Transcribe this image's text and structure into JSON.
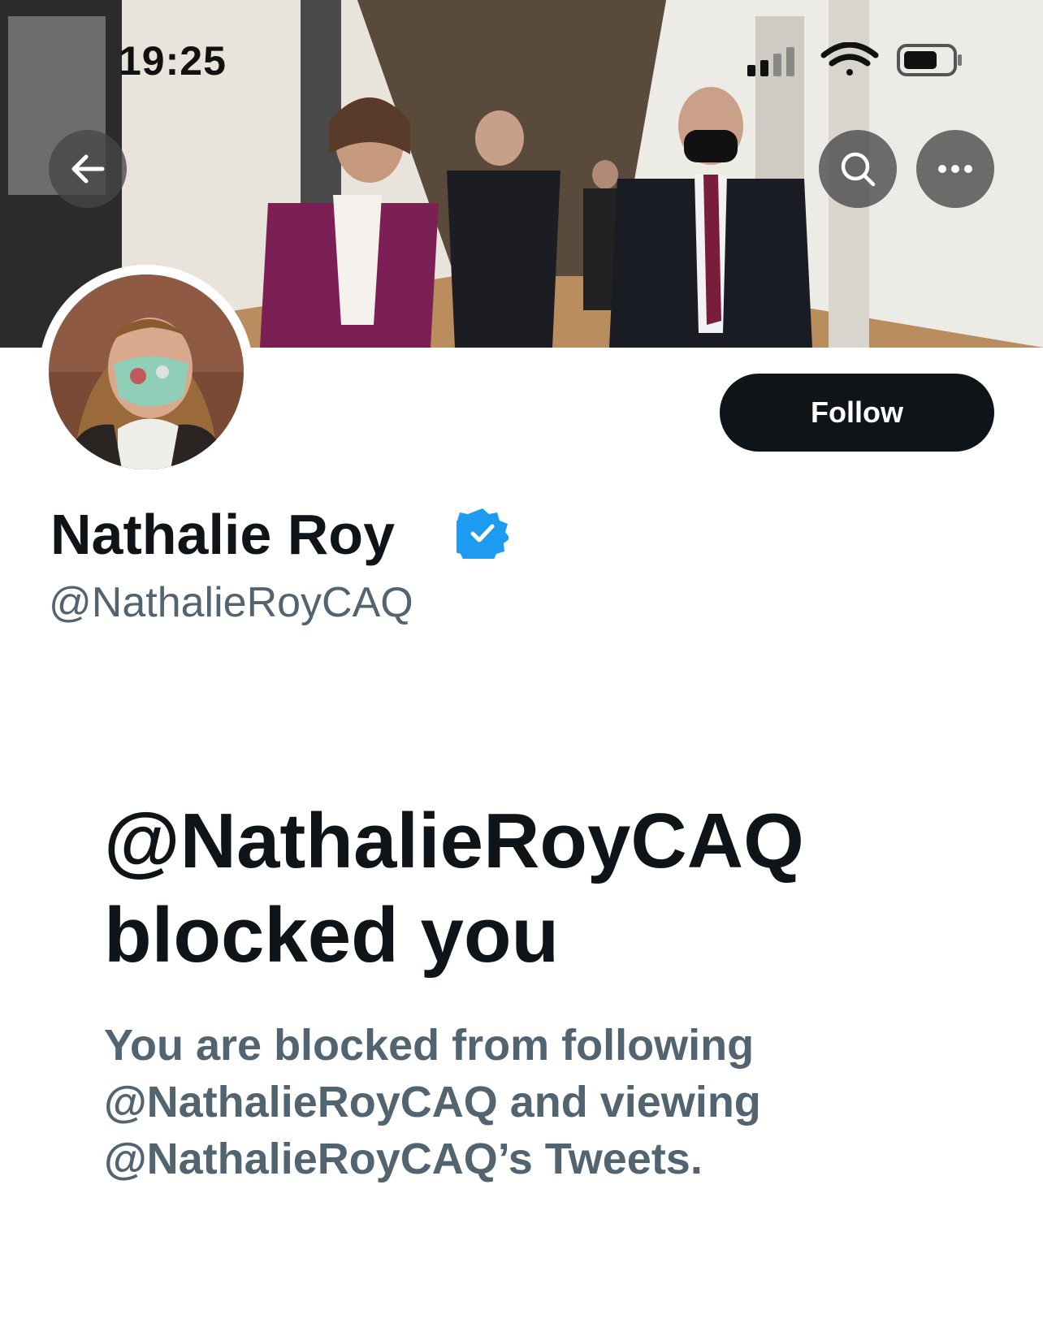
{
  "status_bar": {
    "time": "19:25",
    "icons": [
      "cellular-signal-icon",
      "wifi-icon",
      "battery-icon"
    ]
  },
  "header": {
    "back_icon": "arrow-left-icon",
    "search_icon": "search-icon",
    "more_icon": "more-horizontal-icon"
  },
  "profile": {
    "display_name": "Nathalie Roy",
    "verified_icon": "verified-badge-icon",
    "handle": "@NathalieRoyCAQ",
    "follow_label": "Follow"
  },
  "blocked": {
    "title": "@NathalieRoyCAQ blocked you",
    "description": "You are blocked from following @NathalieRoyCAQ and viewing @NathalieRoyCAQ’s Tweets."
  },
  "colors": {
    "text_primary": "#0f1419",
    "text_secondary": "#536471",
    "verified_blue": "#1d9bf0",
    "button_dark": "#0f1419"
  }
}
